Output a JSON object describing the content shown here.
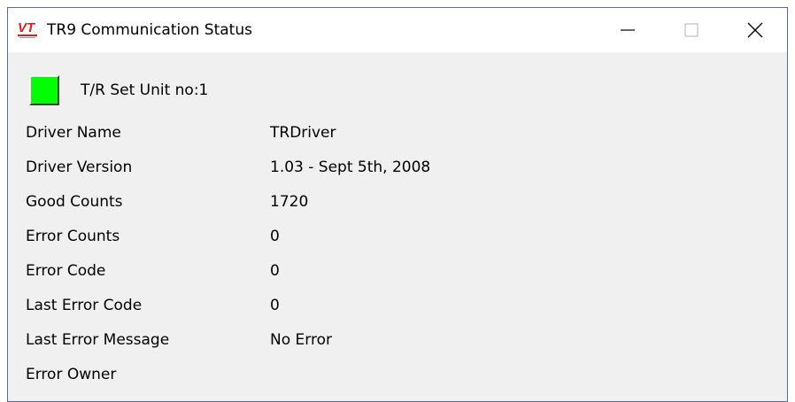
{
  "window": {
    "title": "TR9 Communication Status",
    "icon": "vt-logo-icon",
    "logo_text": "VT",
    "controls": [
      "minimize-icon",
      "maximize-icon",
      "close-icon"
    ]
  },
  "unit": {
    "label": "T/R Set Unit no:1",
    "status_color": "#00ff00"
  },
  "fields": [
    {
      "label": "Driver Name",
      "value": "TRDriver"
    },
    {
      "label": "Driver Version",
      "value": "1.03 - Sept 5th, 2008"
    },
    {
      "label": "Good Counts",
      "value": "1720"
    },
    {
      "label": "Error Counts",
      "value": "0"
    },
    {
      "label": "Error Code",
      "value": "0"
    },
    {
      "label": "Last Error Code",
      "value": "0"
    },
    {
      "label": "Last Error Message",
      "value": "No Error"
    },
    {
      "label": "Error Owner",
      "value": ""
    }
  ]
}
